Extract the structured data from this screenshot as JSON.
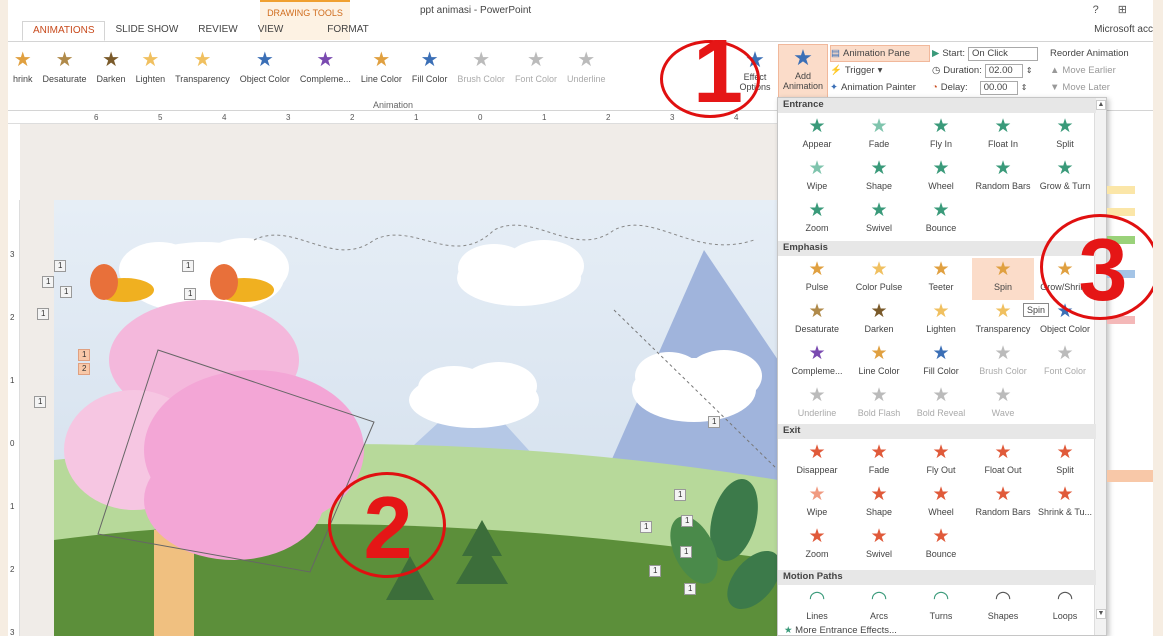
{
  "titlebar": {
    "context_group": "DRAWING TOOLS",
    "doc_title": "ppt animasi - PowerPoint",
    "window_controls": "? ⊞",
    "account": "Microsoft acc"
  },
  "tabs": [
    {
      "label": "ANIMATIONS",
      "active": true
    },
    {
      "label": "SLIDE SHOW"
    },
    {
      "label": "REVIEW"
    },
    {
      "label": "VIEW"
    },
    {
      "label": "FORMAT",
      "context": true
    }
  ],
  "ribbon": {
    "gallery": [
      {
        "label": "hrink",
        "color": "#e0a040"
      },
      {
        "label": "Desaturate",
        "color": "#b08a4a"
      },
      {
        "label": "Darken",
        "color": "#7a5a2a"
      },
      {
        "label": "Lighten",
        "color": "#f0c060"
      },
      {
        "label": "Transparency",
        "color": "#f0c060"
      },
      {
        "label": "Object Color",
        "color": "#3b6fb6"
      },
      {
        "label": "Compleme...",
        "color": "#7a4ab0"
      },
      {
        "label": "Line Color",
        "color": "#e0a040"
      },
      {
        "label": "Fill Color",
        "color": "#3b6fb6"
      },
      {
        "label": "Brush Color",
        "color": "#bbbbbb",
        "disabled": true
      },
      {
        "label": "Font Color",
        "color": "#bbbbbb",
        "disabled": true
      },
      {
        "label": "Underline",
        "color": "#bbbbbb",
        "disabled": true
      }
    ],
    "group_label": "Animation",
    "effect_options": "Effect Options",
    "add_animation": "Add Animation",
    "advanced": {
      "animation_pane": "Animation Pane",
      "trigger": "Trigger",
      "animation_painter": "Animation Painter"
    },
    "timing": {
      "start_label": "Start:",
      "start_value": "On Click",
      "duration_label": "Duration:",
      "duration_value": "02.00",
      "delay_label": "Delay:",
      "delay_value": "00.00"
    },
    "reorder": {
      "title": "Reorder Animation",
      "earlier": "Move Earlier",
      "later": "Move Later"
    }
  },
  "ruler": [
    "6",
    "5",
    "4",
    "3",
    "2",
    "1",
    "0",
    "1",
    "2",
    "3",
    "4"
  ],
  "vruler": [
    "3",
    "2",
    "1",
    "0",
    "1",
    "2",
    "3"
  ],
  "slide_tags": [
    "1",
    "1",
    "1",
    "1",
    "1",
    "1",
    "1",
    "2",
    "1",
    "1",
    "1",
    "1",
    "1",
    "1",
    "1",
    "1"
  ],
  "annotations": [
    "1",
    "2",
    "3"
  ],
  "dropdown": {
    "sections": [
      {
        "title": "Entrance",
        "items": [
          {
            "label": "Appear",
            "color": "#3a9a7a"
          },
          {
            "label": "Fade",
            "color": "#7fc4ad"
          },
          {
            "label": "Fly In",
            "color": "#3a9a7a"
          },
          {
            "label": "Float In",
            "color": "#3a9a7a"
          },
          {
            "label": "Split",
            "color": "#3a9a7a"
          },
          {
            "label": "Wipe",
            "color": "#7fc4ad"
          },
          {
            "label": "Shape",
            "color": "#3a9a7a"
          },
          {
            "label": "Wheel",
            "color": "#3a9a7a"
          },
          {
            "label": "Random Bars",
            "color": "#3a9a7a"
          },
          {
            "label": "Grow & Turn",
            "color": "#3a9a7a"
          },
          {
            "label": "Zoom",
            "color": "#3a9a7a"
          },
          {
            "label": "Swivel",
            "color": "#3a9a7a"
          },
          {
            "label": "Bounce",
            "color": "#3a9a7a"
          }
        ]
      },
      {
        "title": "Emphasis",
        "items": [
          {
            "label": "Pulse",
            "color": "#e0a040"
          },
          {
            "label": "Color Pulse",
            "color": "#f0c060"
          },
          {
            "label": "Teeter",
            "color": "#e0a040"
          },
          {
            "label": "Spin",
            "color": "#e0a040",
            "highlight": true
          },
          {
            "label": "Grow/Shrink",
            "color": "#e0a040"
          },
          {
            "label": "Desaturate",
            "color": "#b08a4a"
          },
          {
            "label": "Darken",
            "color": "#7a5a2a"
          },
          {
            "label": "Lighten",
            "color": "#f0c060"
          },
          {
            "label": "Transparency",
            "color": "#f0c060"
          },
          {
            "label": "Object Color",
            "color": "#3b6fb6"
          },
          {
            "label": "Compleme...",
            "color": "#7a4ab0"
          },
          {
            "label": "Line Color",
            "color": "#e0a040"
          },
          {
            "label": "Fill Color",
            "color": "#3b6fb6"
          },
          {
            "label": "Brush Color",
            "color": "#bbbbbb",
            "disabled": true
          },
          {
            "label": "Font Color",
            "color": "#bbbbbb",
            "disabled": true
          },
          {
            "label": "Underline",
            "color": "#bbbbbb",
            "disabled": true
          },
          {
            "label": "Bold Flash",
            "color": "#bbbbbb",
            "disabled": true
          },
          {
            "label": "Bold Reveal",
            "color": "#bbbbbb",
            "disabled": true
          },
          {
            "label": "Wave",
            "color": "#bbbbbb",
            "disabled": true
          }
        ]
      },
      {
        "title": "Exit",
        "items": [
          {
            "label": "Disappear",
            "color": "#e05a3a"
          },
          {
            "label": "Fade",
            "color": "#e05a3a"
          },
          {
            "label": "Fly Out",
            "color": "#e05a3a"
          },
          {
            "label": "Float Out",
            "color": "#e05a3a"
          },
          {
            "label": "Split",
            "color": "#e05a3a"
          },
          {
            "label": "Wipe",
            "color": "#f09a80"
          },
          {
            "label": "Shape",
            "color": "#e05a3a"
          },
          {
            "label": "Wheel",
            "color": "#e05a3a"
          },
          {
            "label": "Random Bars",
            "color": "#e05a3a"
          },
          {
            "label": "Shrink & Tu...",
            "color": "#e05a3a"
          },
          {
            "label": "Zoom",
            "color": "#e05a3a"
          },
          {
            "label": "Swivel",
            "color": "#e05a3a"
          },
          {
            "label": "Bounce",
            "color": "#e05a3a"
          }
        ]
      },
      {
        "title": "Motion Paths",
        "items": [
          {
            "label": "Lines",
            "color": "#3a9a7a"
          },
          {
            "label": "Arcs",
            "color": "#3a9a7a"
          },
          {
            "label": "Turns",
            "color": "#3a9a7a"
          },
          {
            "label": "Shapes",
            "color": "#555555"
          },
          {
            "label": "Loops",
            "color": "#555555"
          }
        ]
      }
    ],
    "more": "More Entrance Effects..."
  },
  "tooltip": "Spin",
  "colors": {
    "accent": "#c84a1c",
    "highlight": "#fbdcc9",
    "annotation": "#e01010"
  }
}
